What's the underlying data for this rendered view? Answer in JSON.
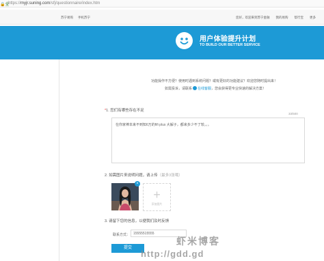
{
  "browser": {
    "secure_icon": "lock-icon",
    "secure_label": "全",
    "url_scheme": "https://",
    "url_host": "myjr.suning.com",
    "url_path": "/sfj/questionnaire/index.htm"
  },
  "topnav": {
    "left": [
      "苏宁易购",
      "手机苏宁"
    ],
    "right": [
      "您好，欢迎来到苏宁金融",
      "我的易购",
      "帮行宝",
      "更多"
    ]
  },
  "banner": {
    "icon": "smiley-icon",
    "title": "用户体验提升计划",
    "subtitle": "TO BUILD OUR BETTER SERVICE"
  },
  "intro": {
    "line1": "功能操作不方便？使用时遇到系统问题？或有更好的功能建议？欢迎您随时提出来！",
    "line2_a": "如需投诉，请联系",
    "line2_link": "在线客服",
    "line2_b": "，您会获得更专业快速的解决方案！"
  },
  "q1": {
    "num": "1.",
    "star": "*",
    "text": "您们有哪些存在不足",
    "counter": "33/500",
    "answer": "在你家棒本来不到知6万的fifi plus 大解子，都来多少不了较。。。"
  },
  "q2": {
    "num": "2.",
    "text": "如需图片来说明问题，请上传",
    "hint": "（最多3张哦）",
    "add_label": "添加图片",
    "delete_symbol": "×"
  },
  "q3": {
    "num": "3.",
    "text": "请留下您的信息，以便我们及时反馈",
    "contact_label": "联系方式：",
    "contact_value": "15555515555"
  },
  "submit_label": "提交",
  "watermark": {
    "line1": "虾米博客",
    "line2": "http://gdd.gd"
  }
}
